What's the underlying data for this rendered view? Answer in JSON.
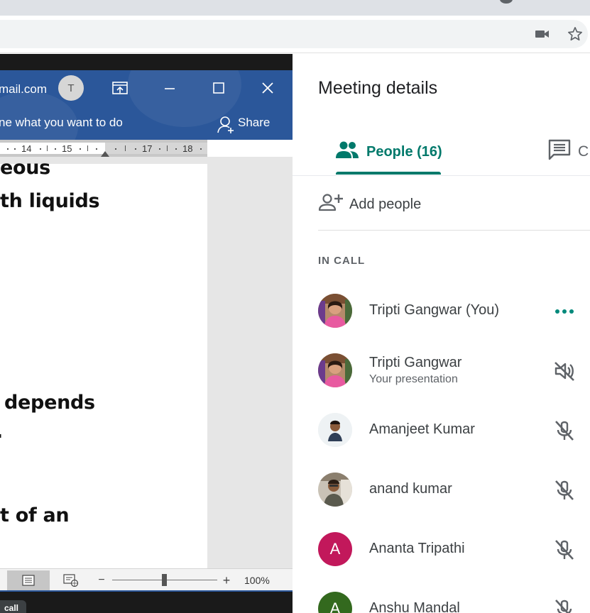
{
  "browser": {
    "icons": [
      "video-camera-icon",
      "star-icon"
    ]
  },
  "word_window": {
    "account_email": "mail.com",
    "avatar_initial": "T",
    "tell_me_placeholder": "ne what you want to do",
    "share_label": "Share",
    "ruler_numbers": [
      "14",
      "15",
      "17",
      "18"
    ],
    "document_lines": [
      "eous",
      "th liquids",
      "depends",
      ".",
      "t of an"
    ],
    "zoom_minus": "−",
    "zoom_plus": "+",
    "zoom_level": "100%"
  },
  "call_tag": "call",
  "meeting_panel": {
    "title": "Meeting details",
    "tabs": [
      {
        "label": "People (16)",
        "icon": "people-icon",
        "active": true
      },
      {
        "label": "C",
        "icon": "chat-icon",
        "active": false
      }
    ],
    "add_people_label": "Add people",
    "section_label": "IN CALL",
    "accent_color": "#00796b",
    "participants": [
      {
        "name": "Tripti Gangwar (You)",
        "subtitle": "",
        "avatar": "photo",
        "action_icon": "more-options-icon"
      },
      {
        "name": "Tripti Gangwar",
        "subtitle": "Your presentation",
        "avatar": "photo",
        "action_icon": "volume-muted-icon"
      },
      {
        "name": "Amanjeet Kumar",
        "subtitle": "",
        "avatar": "photo",
        "action_icon": "mic-off-icon"
      },
      {
        "name": "anand kumar",
        "subtitle": "",
        "avatar": "photo",
        "action_icon": "mic-off-icon"
      },
      {
        "name": "Ananta Tripathi",
        "subtitle": "",
        "avatar_letter": "A",
        "avatar_color": "#c2185b",
        "action_icon": "mic-off-icon"
      },
      {
        "name": "Anshu Mandal",
        "subtitle": "",
        "avatar_letter": "A",
        "avatar_color": "#33691e",
        "action_icon": "mic-off-icon"
      }
    ]
  }
}
